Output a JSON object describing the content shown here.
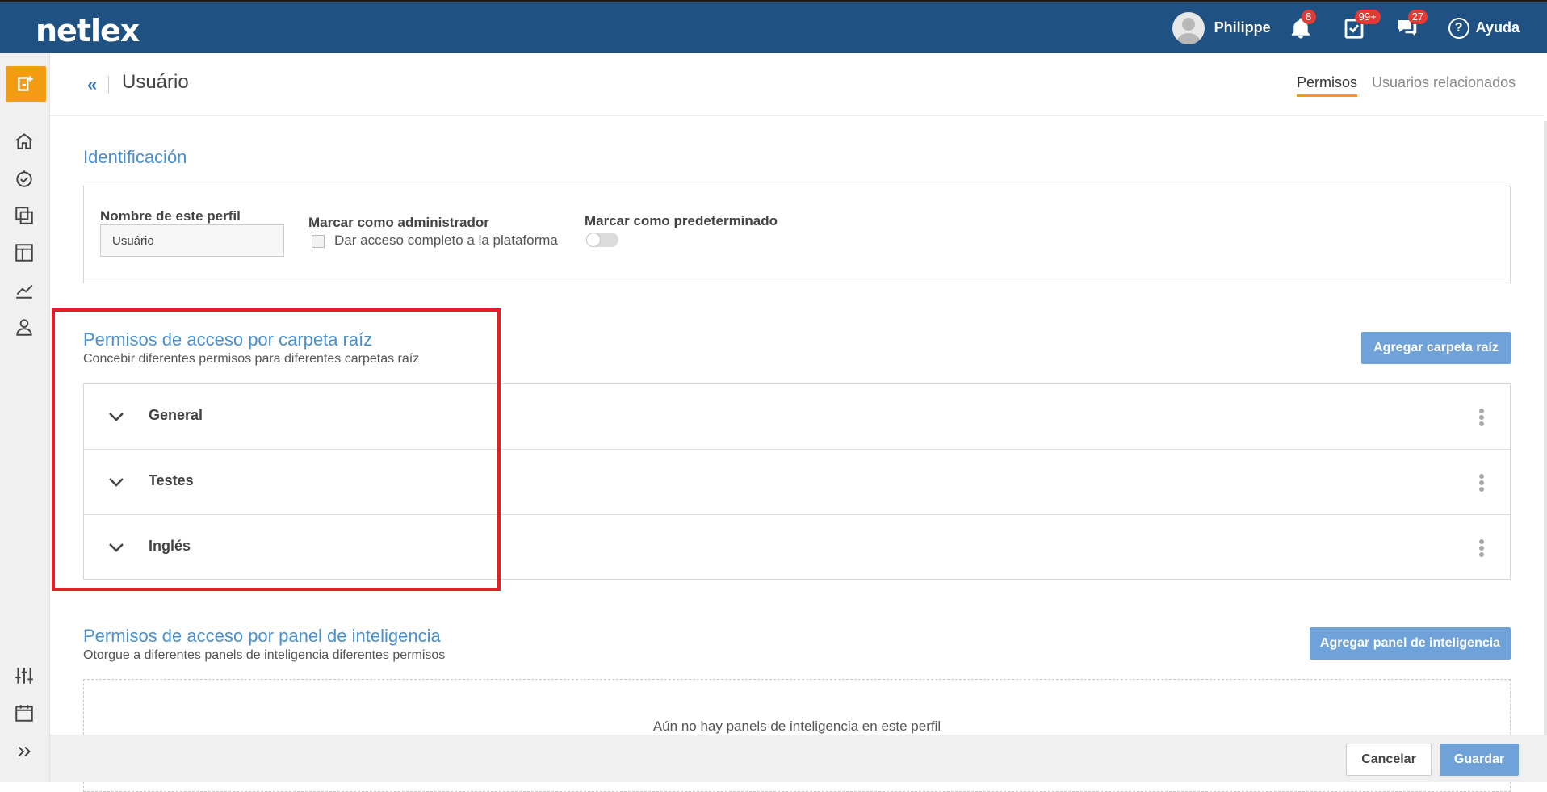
{
  "app": {
    "logo": "netlex"
  },
  "topbar": {
    "user_name": "Philippe",
    "notifications_count": "8",
    "tasks_count": "99+",
    "messages_count": "27",
    "help_label": "Ayuda",
    "help_symbol": "?"
  },
  "header": {
    "title": "Usuário",
    "back_symbol": "«",
    "tabs": [
      {
        "label": "Permisos",
        "active": true
      },
      {
        "label": "Usuarios relacionados",
        "active": false
      }
    ]
  },
  "identification": {
    "title": "Identificación",
    "profile_name_label": "Nombre de este perfil",
    "profile_name_value": "Usuário",
    "admin_label": "Marcar como administrador",
    "admin_checkbox_label": "Dar acceso completo a la plataforma",
    "admin_checked": false,
    "default_label": "Marcar como predeterminado",
    "default_on": false
  },
  "root_folders": {
    "title": "Permisos de acceso por carpeta raíz",
    "subtitle": "Concebir diferentes permisos para diferentes carpetas raíz",
    "add_button": "Agregar carpeta raíz",
    "items": [
      {
        "name": "General"
      },
      {
        "name": "Testes"
      },
      {
        "name": "Inglés"
      }
    ]
  },
  "intelligence": {
    "title": "Permisos de acceso por panel de inteligencia",
    "subtitle": "Otorgue a diferentes panels de inteligencia diferentes permisos",
    "add_button": "Agregar panel de inteligencia",
    "empty_text": "Aún no hay panels de inteligencia en este perfil"
  },
  "footer": {
    "cancel_label": "Cancelar",
    "save_label": "Guardar"
  },
  "colors": {
    "topbar": "#1f5282",
    "accent": "#4a8fcf",
    "button": "#6fa2d8",
    "orange": "#f39c12",
    "highlight": "#e31e24"
  }
}
